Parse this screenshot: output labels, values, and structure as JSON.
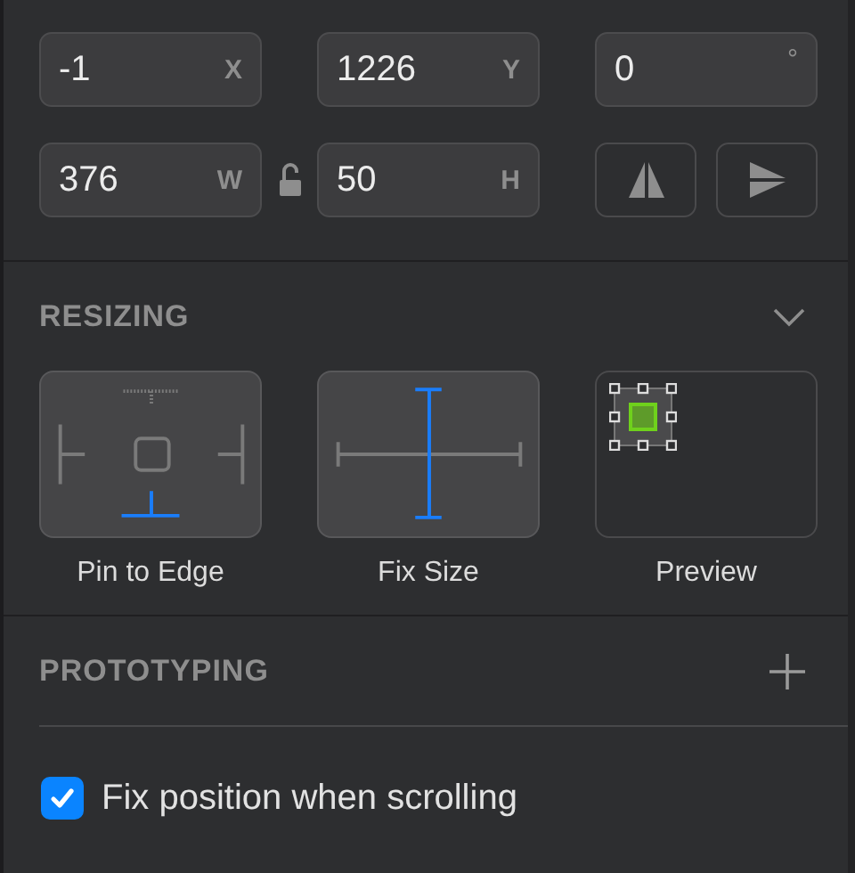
{
  "position_fields": [
    {
      "value": "-1",
      "unit": "X"
    },
    {
      "value": "1226",
      "unit": "Y"
    },
    {
      "value": "0",
      "unit": "°"
    }
  ],
  "size_fields": [
    {
      "value": "376",
      "unit": "W"
    },
    {
      "value": "50",
      "unit": "H"
    }
  ],
  "size_locked": false,
  "resizing": {
    "title": "RESIZING",
    "expanded": true,
    "options": [
      {
        "kind": "pin",
        "label": "Pin to Edge"
      },
      {
        "kind": "fix",
        "label": "Fix Size"
      },
      {
        "kind": "preview",
        "label": "Preview"
      }
    ]
  },
  "prototyping": {
    "title": "PROTOTYPING",
    "option": {
      "label": "Fix position when scrolling",
      "checked": true
    }
  }
}
